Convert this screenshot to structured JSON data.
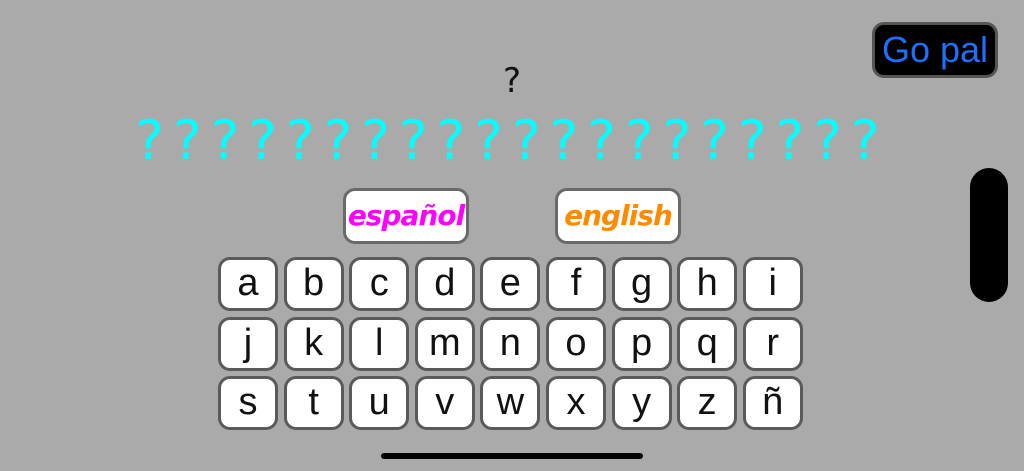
{
  "header": {
    "go_label": "Go pal"
  },
  "puzzle": {
    "clue": "?",
    "answer": "????????????????????"
  },
  "languages": {
    "spanish": "español",
    "english": "english"
  },
  "keyboard": {
    "keys": [
      "a",
      "b",
      "c",
      "d",
      "e",
      "f",
      "g",
      "h",
      "i",
      "j",
      "k",
      "l",
      "m",
      "n",
      "o",
      "p",
      "q",
      "r",
      "s",
      "t",
      "u",
      "v",
      "w",
      "x",
      "y",
      "z",
      "ñ"
    ]
  },
  "colors": {
    "background": "#aaaaaa",
    "answer_text": "#00ffff",
    "go_text": "#1f6fff",
    "spanish_text": "#ff00ff",
    "english_text": "#ff8a00"
  }
}
